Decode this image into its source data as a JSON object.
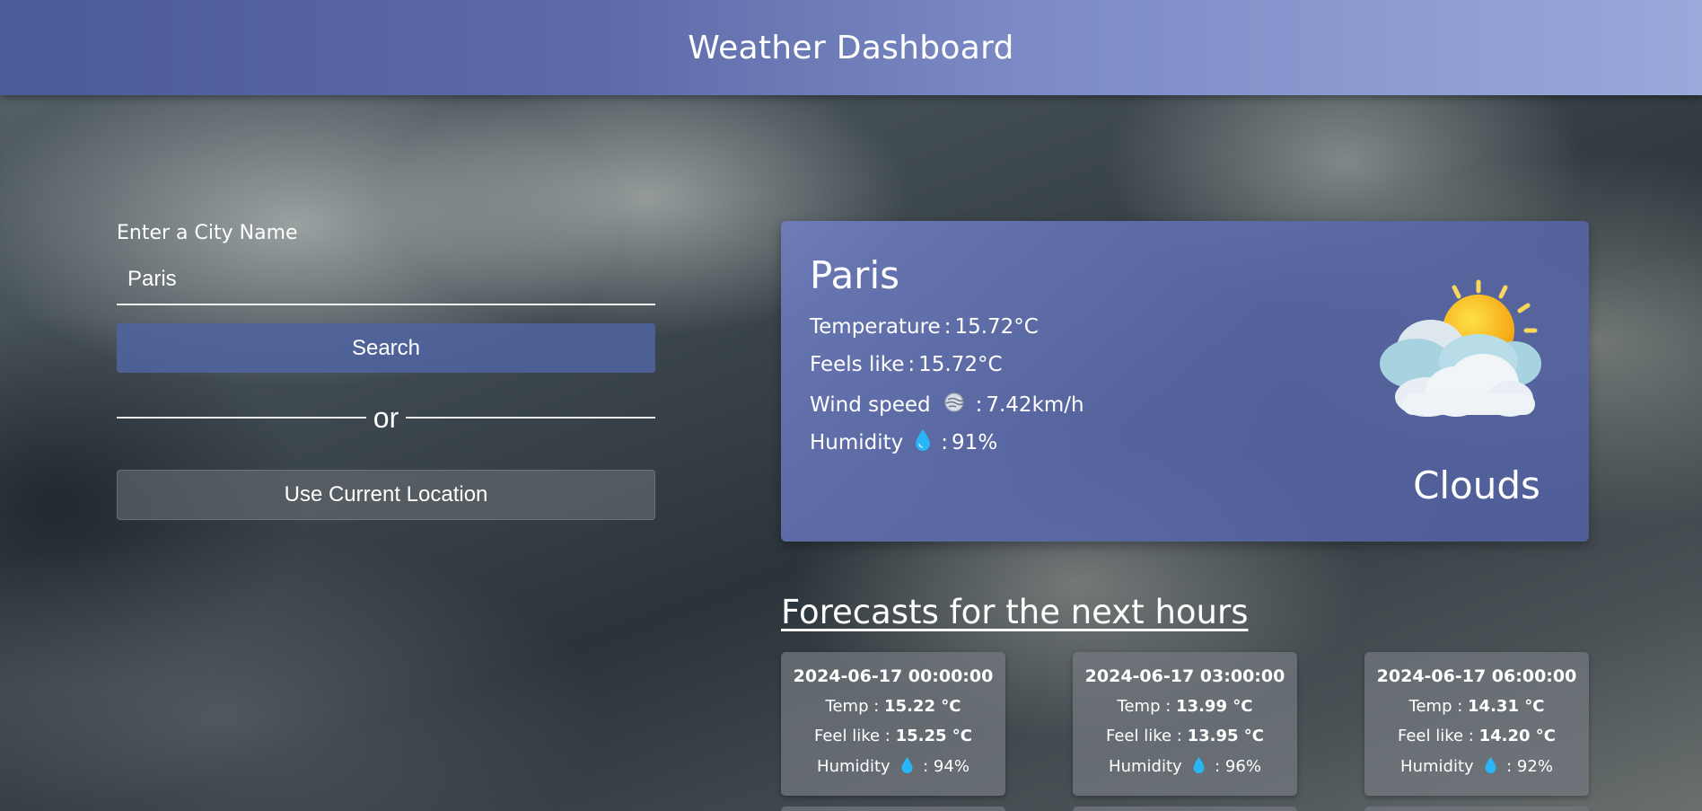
{
  "header": {
    "title": "Weather Dashboard"
  },
  "search": {
    "label": "Enter a City Name",
    "value": "Paris",
    "button_label": "Search",
    "or_text": "or",
    "location_button_label": "Use Current Location"
  },
  "current": {
    "city": "Paris",
    "temperature_label": "Temperature",
    "temperature": "15.72°C",
    "feels_like_label": "Feels like",
    "feels_like": "15.72°C",
    "wind_label": "Wind speed",
    "wind": "7.42km/h",
    "humidity_label": "Humidity",
    "humidity": "91%",
    "separator": ":",
    "condition": "Clouds",
    "icon": "partly-cloudy-sun-icon"
  },
  "forecast": {
    "title": "Forecasts for the next hours",
    "temp_label": "Temp :",
    "feel_label": "Feel like :",
    "humidity_label": "Humidity",
    "items": [
      {
        "datetime": "2024-06-17 00:00:00",
        "temp": "15.22 °C",
        "feel": "15.25 °C",
        "humidity": ": 94%"
      },
      {
        "datetime": "2024-06-17 03:00:00",
        "temp": "13.99 °C",
        "feel": "13.95 °C",
        "humidity": ": 96%"
      },
      {
        "datetime": "2024-06-17 06:00:00",
        "temp": "14.31 °C",
        "feel": "14.20 °C",
        "humidity": ": 92%"
      }
    ]
  },
  "colors": {
    "header": "#5d6aa8",
    "card": "#6a7bbd",
    "search_button": "#5064a0",
    "drop": "#29b6f6"
  }
}
